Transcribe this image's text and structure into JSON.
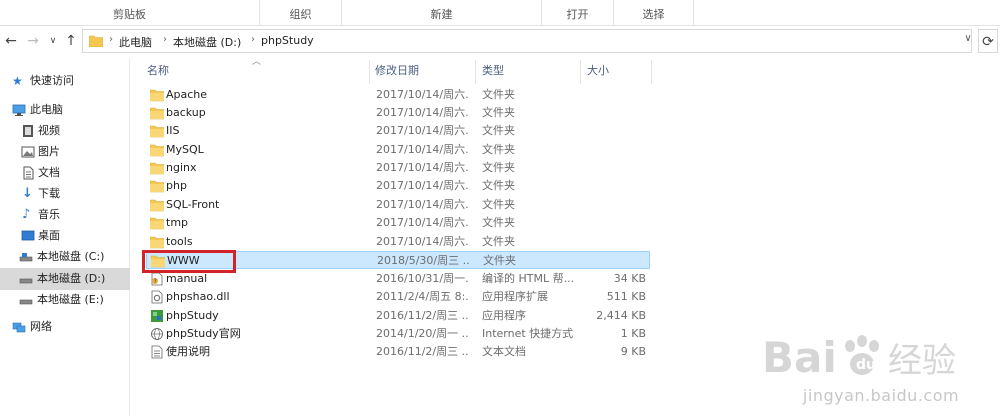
{
  "ribbon": {
    "groups": [
      "剪贴板",
      "组织",
      "新建",
      "打开",
      "选择"
    ]
  },
  "address": {
    "crumbs": [
      "此电脑",
      "本地磁盘 (D:)",
      "phpStudy"
    ]
  },
  "nav_pane": {
    "items": [
      {
        "label": "快速访问",
        "icon": "star-icon"
      },
      {
        "label": "此电脑",
        "icon": "computer-icon"
      },
      {
        "label": "视频",
        "icon": "video-icon"
      },
      {
        "label": "图片",
        "icon": "picture-icon"
      },
      {
        "label": "文档",
        "icon": "document-icon"
      },
      {
        "label": "下载",
        "icon": "download-icon"
      },
      {
        "label": "音乐",
        "icon": "music-icon"
      },
      {
        "label": "桌面",
        "icon": "desktop-icon"
      },
      {
        "label": "本地磁盘 (C:)",
        "icon": "drive-icon"
      },
      {
        "label": "本地磁盘 (D:)",
        "icon": "drive-icon"
      },
      {
        "label": "本地磁盘 (E:)",
        "icon": "drive-icon"
      },
      {
        "label": "网络",
        "icon": "network-icon"
      }
    ],
    "selected": "本地磁盘 (D:)"
  },
  "columns": {
    "name": "名称",
    "date": "修改日期",
    "type": "类型",
    "size": "大小"
  },
  "files": [
    {
      "name": "Apache",
      "date": "2017/10/14/周六...",
      "type": "文件夹",
      "size": "",
      "icon": "folder-icon"
    },
    {
      "name": "backup",
      "date": "2017/10/14/周六...",
      "type": "文件夹",
      "size": "",
      "icon": "folder-icon"
    },
    {
      "name": "IIS",
      "date": "2017/10/14/周六...",
      "type": "文件夹",
      "size": "",
      "icon": "folder-icon"
    },
    {
      "name": "MySQL",
      "date": "2017/10/14/周六...",
      "type": "文件夹",
      "size": "",
      "icon": "folder-icon"
    },
    {
      "name": "nginx",
      "date": "2017/10/14/周六...",
      "type": "文件夹",
      "size": "",
      "icon": "folder-icon"
    },
    {
      "name": "php",
      "date": "2017/10/14/周六...",
      "type": "文件夹",
      "size": "",
      "icon": "folder-icon"
    },
    {
      "name": "SQL-Front",
      "date": "2017/10/14/周六...",
      "type": "文件夹",
      "size": "",
      "icon": "folder-icon"
    },
    {
      "name": "tmp",
      "date": "2017/10/14/周六...",
      "type": "文件夹",
      "size": "",
      "icon": "folder-icon"
    },
    {
      "name": "tools",
      "date": "2017/10/14/周六...",
      "type": "文件夹",
      "size": "",
      "icon": "folder-icon"
    },
    {
      "name": "WWW",
      "date": "2018/5/30/周三 ...",
      "type": "文件夹",
      "size": "",
      "icon": "folder-icon"
    },
    {
      "name": "manual",
      "date": "2016/10/31/周一...",
      "type": "编译的 HTML 帮...",
      "size": "34 KB",
      "icon": "help-file-icon"
    },
    {
      "name": "phpshao.dll",
      "date": "2011/2/4/周五 8:...",
      "type": "应用程序扩展",
      "size": "511 KB",
      "icon": "dll-file-icon"
    },
    {
      "name": "phpStudy",
      "date": "2016/11/2/周三 ...",
      "type": "应用程序",
      "size": "2,414 KB",
      "icon": "app-icon"
    },
    {
      "name": "phpStudy官网",
      "date": "2014/1/20/周一 ...",
      "type": "Internet 快捷方式",
      "size": "1 KB",
      "icon": "shortcut-icon"
    },
    {
      "name": "使用说明",
      "date": "2016/11/2/周三 ...",
      "type": "文本文档",
      "size": "9 KB",
      "icon": "text-file-icon"
    }
  ],
  "selected_file": "WWW",
  "watermark": {
    "logo_text": "Bai 经验",
    "url": "jingyan.baidu.com"
  },
  "colors": {
    "folder": "#f5c951",
    "selection": "#cce8ff",
    "highlight_box": "#d22428",
    "header_text": "#4d6082"
  }
}
